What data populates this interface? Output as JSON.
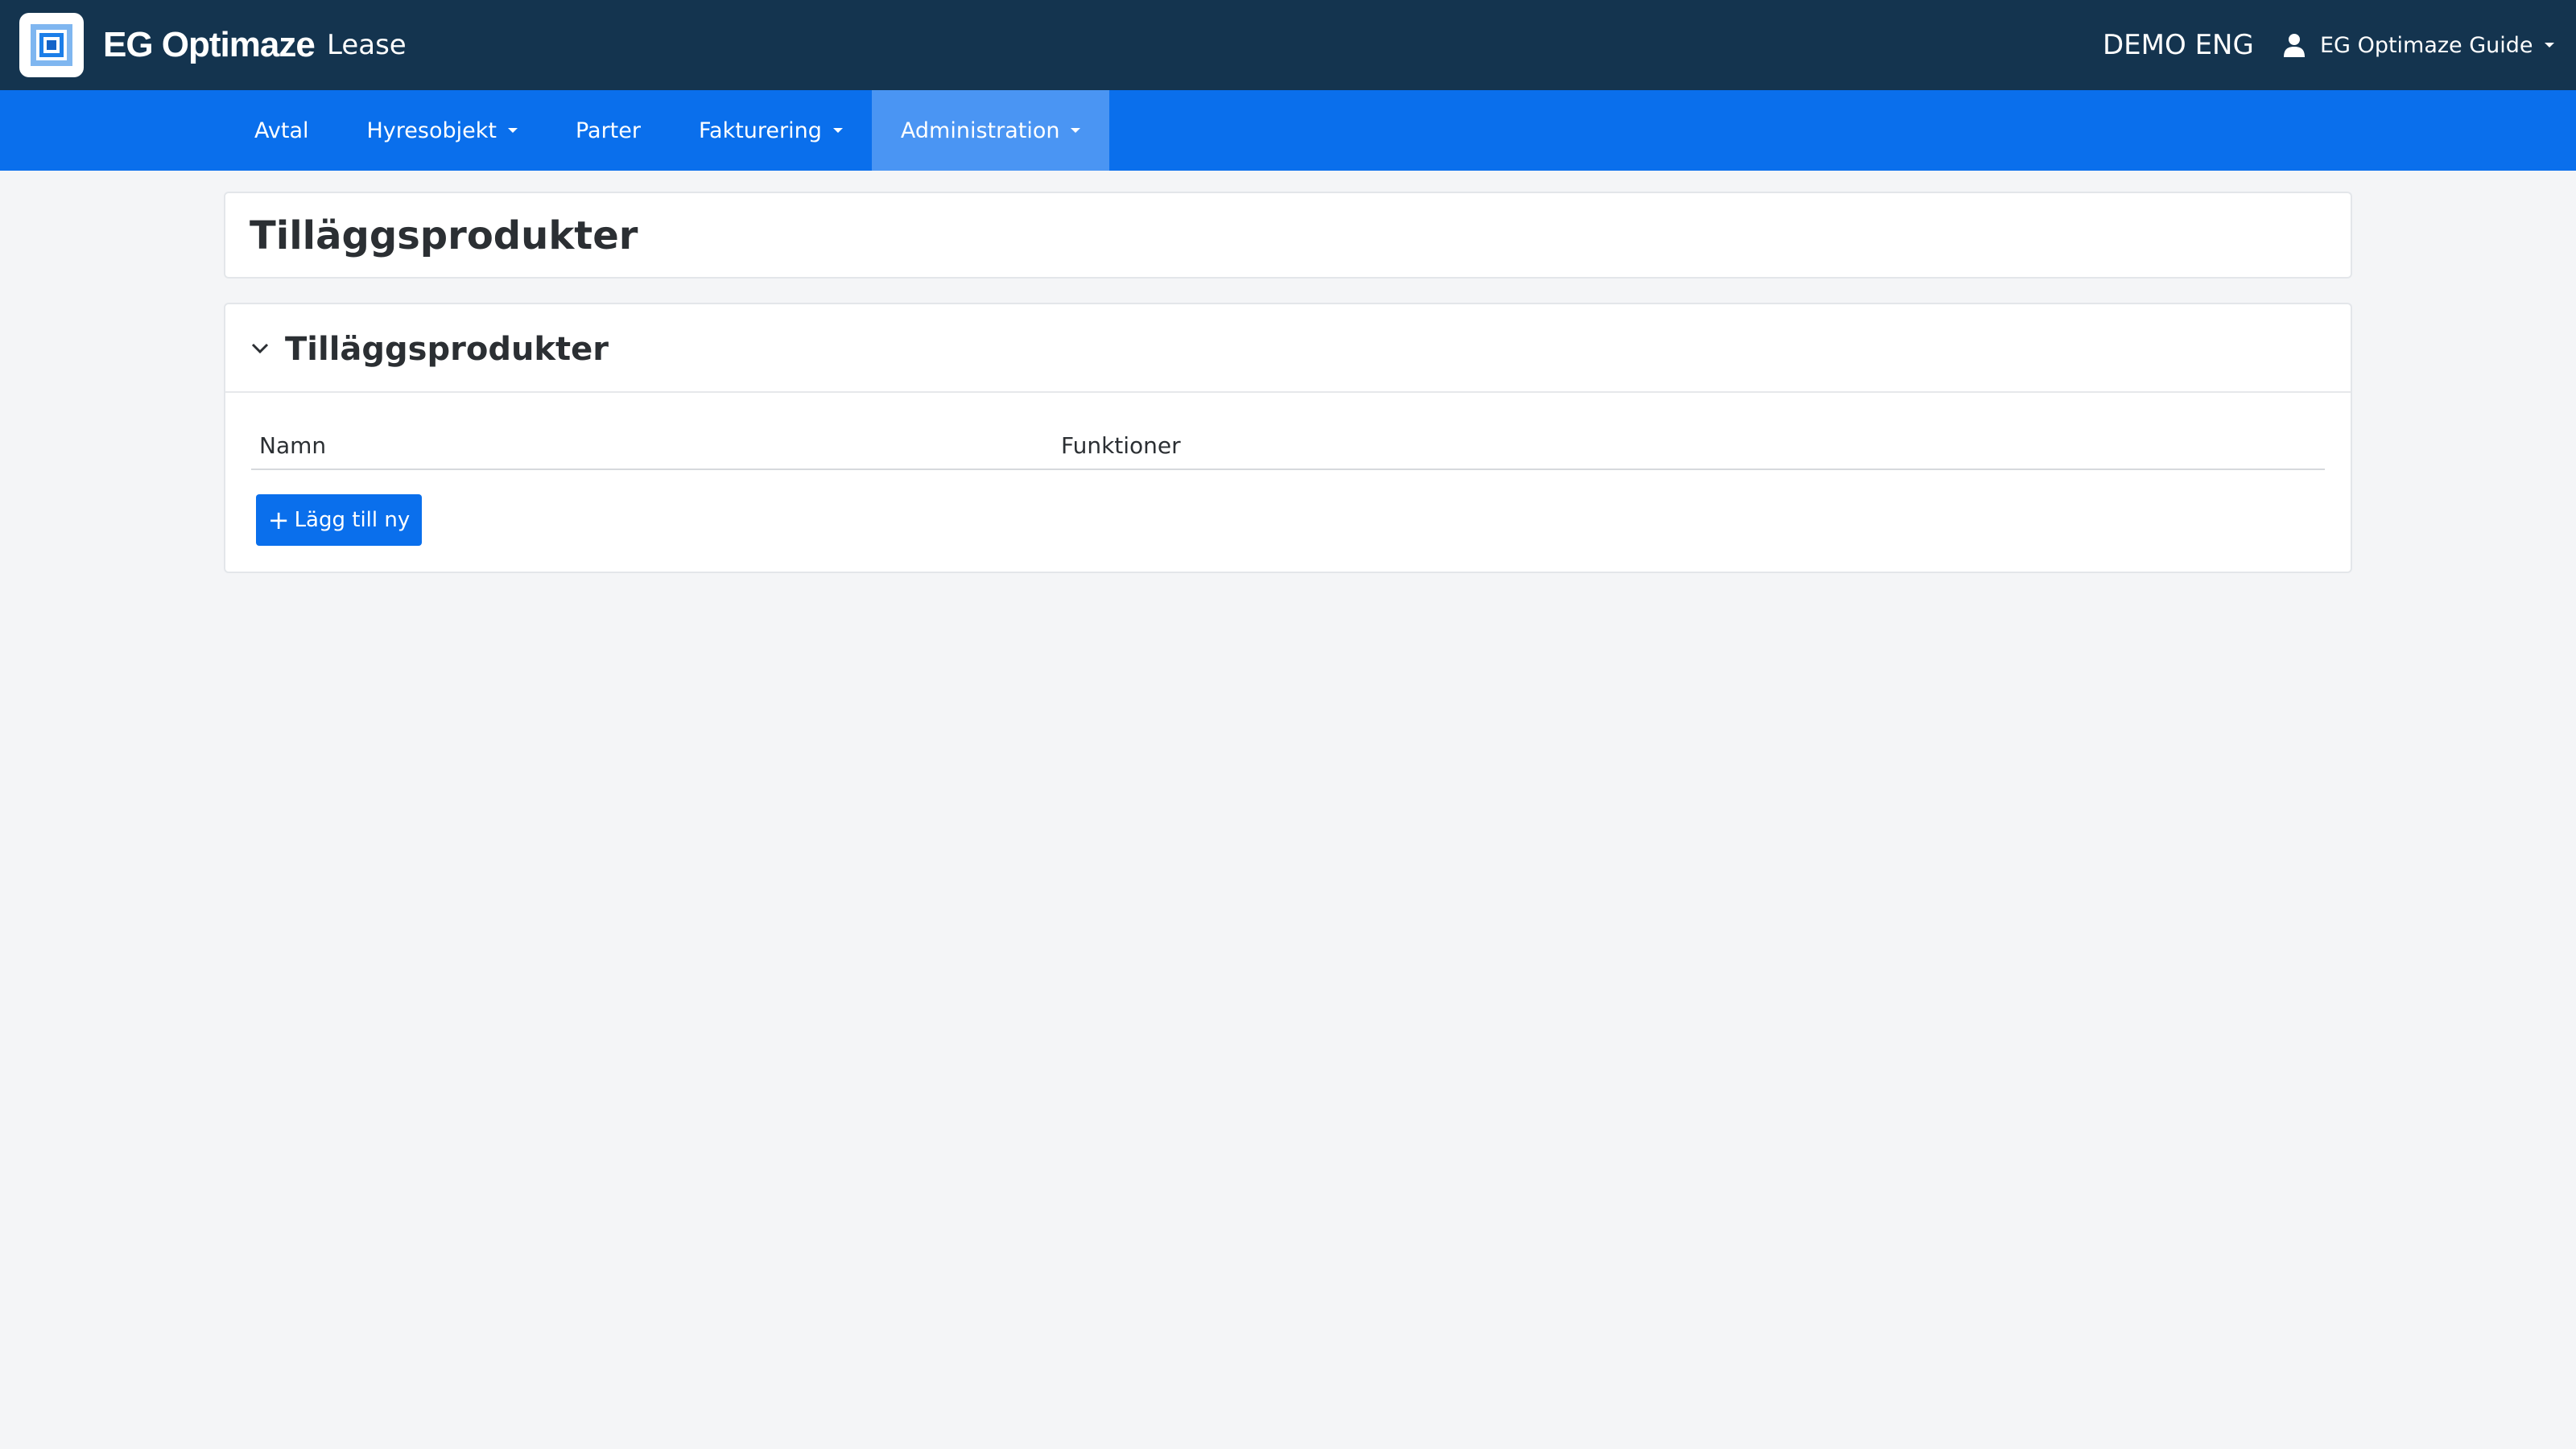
{
  "header": {
    "brand": "EG Optimaze",
    "product": "Lease",
    "organization": "DEMO ENG",
    "user_name": "EG Optimaze Guide",
    "user_icon": "user-icon",
    "background_color": "#14344f"
  },
  "nav": {
    "background_color": "#0a6fec",
    "active_color": "#4a95f3",
    "items": [
      {
        "label": "Avtal",
        "has_dropdown": false,
        "active": false
      },
      {
        "label": "Hyresobjekt",
        "has_dropdown": true,
        "active": false
      },
      {
        "label": "Parter",
        "has_dropdown": false,
        "active": false
      },
      {
        "label": "Fakturering",
        "has_dropdown": true,
        "active": false
      },
      {
        "label": "Administration",
        "has_dropdown": true,
        "active": true
      }
    ]
  },
  "page": {
    "title": "Tilläggsprodukter"
  },
  "section": {
    "title": "Tilläggsprodukter",
    "expanded": true,
    "toggle_icon": "chevron-down-icon",
    "table": {
      "columns": [
        "Namn",
        "Funktioner"
      ],
      "rows": []
    },
    "add_button_label": "Lägg till ny",
    "add_button_icon": "plus-icon"
  }
}
